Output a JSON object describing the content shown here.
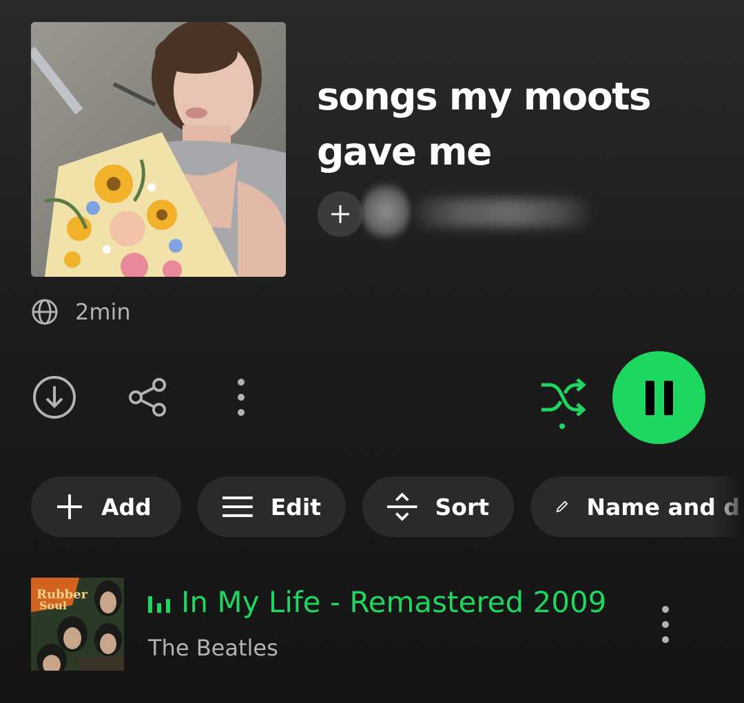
{
  "playlist": {
    "title": "songs my moots gave me",
    "duration": "2min",
    "visibility_icon": "globe-icon",
    "owner_name": ""
  },
  "actions": {
    "download_icon": "download-icon",
    "share_icon": "share-icon",
    "more_icon": "more-vertical-icon",
    "shuffle_icon": "shuffle-icon",
    "play_state": "pause-icon"
  },
  "chips": [
    {
      "label": "Add",
      "icon": "plus-icon"
    },
    {
      "label": "Edit",
      "icon": "list-icon"
    },
    {
      "label": "Sort",
      "icon": "sort-icon"
    },
    {
      "label": "Name and d",
      "icon": "pencil-icon"
    }
  ],
  "tracks": [
    {
      "title": "In My Life - Remastered 2009",
      "artist": "The Beatles",
      "now_playing": true
    }
  ],
  "colors": {
    "accent": "#1ed760",
    "background": "#1c1c1c",
    "chip": "#2a2a2a",
    "muted_text": "#b3b3b3"
  }
}
